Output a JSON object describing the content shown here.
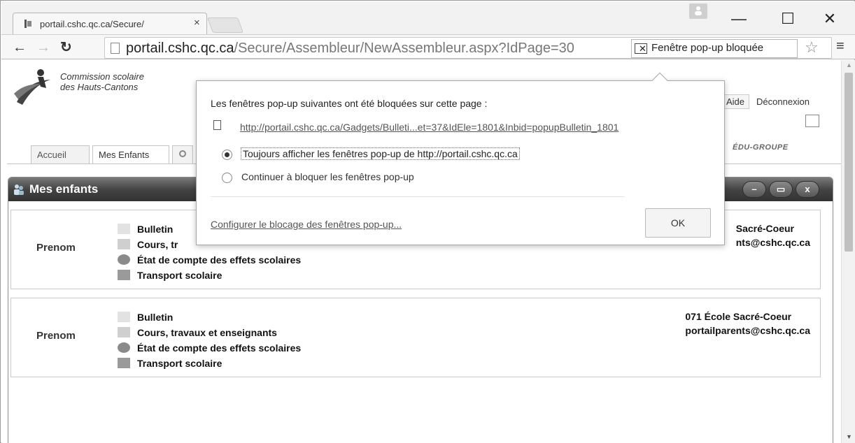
{
  "browser": {
    "tab_title": "portail.cshc.qc.ca/Secure/",
    "tab_close": "×",
    "window_buttons": {
      "minimize": "—",
      "maximize": "☐",
      "close": "✕"
    },
    "url_host": "portail.cshc.qc.ca",
    "url_path": "/Secure/Assembleur/NewAssembleur.aspx?IdPage=30",
    "popup_chip_label": "Fenêtre pop-up bloquée",
    "icons": {
      "back": "back-arrow-icon",
      "forward": "forward-arrow-icon",
      "reload": "reload-icon",
      "star": "bookmark-star-icon",
      "menu": "hamburger-menu-icon"
    }
  },
  "site": {
    "logo_line1": "Commission scolaire",
    "logo_line2": "des Hauts-Cantons",
    "header_links": [
      "Aide",
      "Déconnexion"
    ],
    "edu_label": "ÉDU-GROUPE",
    "nav_tabs": [
      "Accueil",
      "Mes Enfants"
    ]
  },
  "panel": {
    "title": "Mes enfants",
    "buttons": {
      "minimize": "–",
      "maximize": "▭",
      "close": "x"
    }
  },
  "children": [
    {
      "name": "Prenom",
      "links": [
        "Bulletin",
        "Cours, tr",
        "État de compte des effets scolaires",
        "Transport scolaire"
      ],
      "school_line1": "Sacré-Coeur",
      "school_line2": "nts@cshc.qc.ca"
    },
    {
      "name": "Prenom",
      "links": [
        "Bulletin",
        "Cours, travaux et enseignants",
        "État de compte des effets scolaires",
        "Transport scolaire"
      ],
      "school_line1": "071 École Sacré-Coeur",
      "school_line2": "portailparents@cshc.qc.ca"
    }
  ],
  "popup_bubble": {
    "message": "Les fenêtres pop-up suivantes ont été bloquées sur cette page :",
    "blocked_link": "http://portail.cshc.qc.ca/Gadgets/Bulleti...et=37&IdEle=1801&Inbid=popupBulletin_1801",
    "option_always": "Toujours afficher les fenêtres pop-up de http://portail.cshc.qc.ca",
    "option_block": "Continuer à bloquer les fenêtres pop-up",
    "selected_option": "always",
    "config_link": "Configurer le blocage des fenêtres pop-up...",
    "ok_label": "OK"
  }
}
